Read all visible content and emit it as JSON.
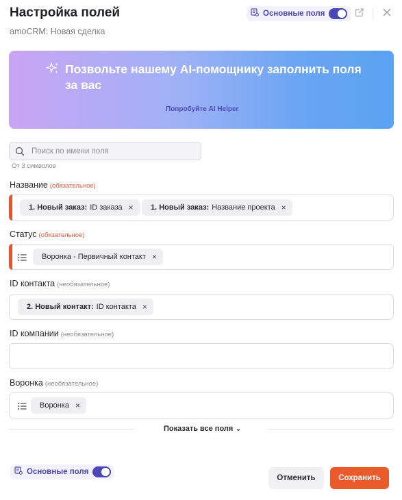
{
  "header": {
    "title": "Настройка полей",
    "subtitle": "amoCRM: Новая сделка",
    "toggle_label": "Основные поля"
  },
  "banner": {
    "headline": "Позвольте нашему AI-помощнику заполнить поля за вас",
    "cta": "Попробуйте AI Helper"
  },
  "search": {
    "placeholder": "Поиск по имени поля",
    "value": "",
    "hint": "От 3 символов"
  },
  "fields": [
    {
      "label": "Название",
      "tag": "(обязательное)",
      "chips": [
        {
          "bold": "1. Новый заказ:",
          "text": "ID заказа"
        },
        {
          "bold": "1. Новый заказ:",
          "text": "Название проекта"
        }
      ]
    },
    {
      "label": "Статус",
      "tag": "(обязательное)",
      "chips": [
        {
          "text": "Воронка - Первичный контакт"
        }
      ]
    },
    {
      "label": "ID контакта",
      "tag": "(необязательное)",
      "chips": [
        {
          "bold": "2. Новый контакт:",
          "text": "ID контакта"
        }
      ]
    },
    {
      "label": "ID компании",
      "tag": "(необязательное)",
      "chips": []
    },
    {
      "label": "Воронка",
      "tag": "(необязательное)",
      "chips": [
        {
          "text": "Воронка"
        }
      ]
    }
  ],
  "show_all": "Показать все поля",
  "footer": {
    "toggle_label": "Основные поля",
    "cancel_label": "Отменить",
    "save_label": "Сохранить"
  },
  "icons": {
    "chip_remove": "×",
    "chevron": "⌄"
  },
  "colors": {
    "accent": "#4b47b6",
    "required": "#e8552d",
    "save": "#ea5a2b"
  }
}
